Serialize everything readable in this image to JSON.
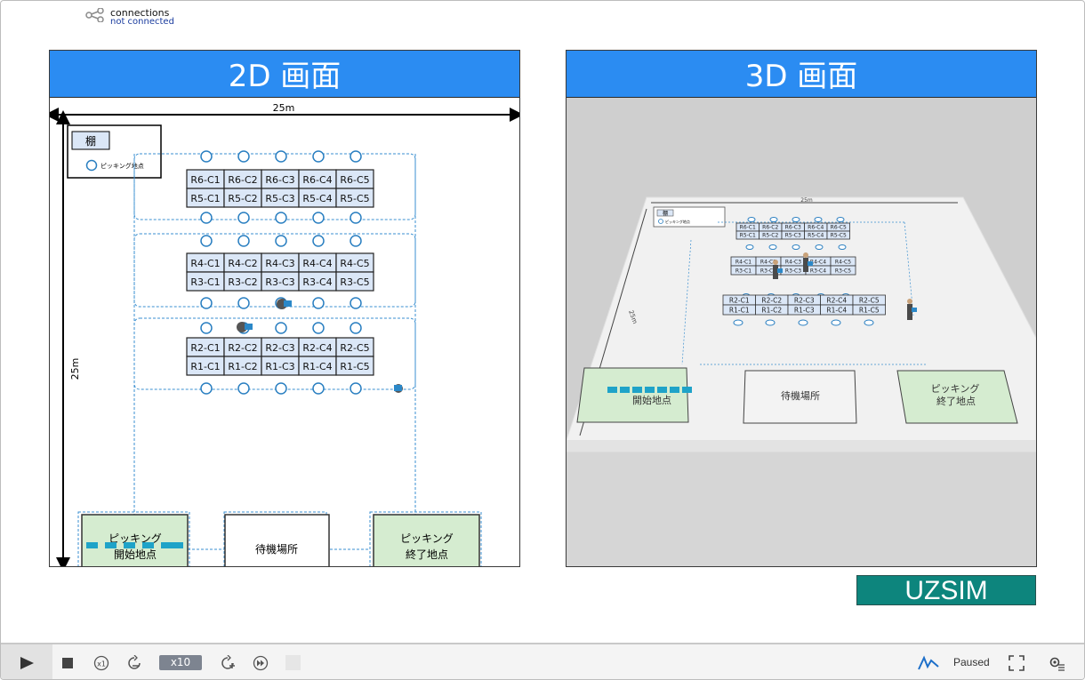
{
  "connection": {
    "label": "connections",
    "status": "not connected"
  },
  "panels": {
    "view2d_title": "2D 画面",
    "view3d_title": "3D 画面"
  },
  "layout2d": {
    "width_label": "25m",
    "height_label": "25m",
    "legend_shelf": "棚",
    "legend_point": "ピッキング地点",
    "shelf_rows": [
      [
        "R6-C1",
        "R6-C2",
        "R6-C3",
        "R6-C4",
        "R6-C5"
      ],
      [
        "R5-C1",
        "R5-C2",
        "R5-C3",
        "R5-C4",
        "R5-C5"
      ],
      [
        "R4-C1",
        "R4-C2",
        "R4-C3",
        "R4-C4",
        "R4-C5"
      ],
      [
        "R3-C1",
        "R3-C2",
        "R3-C3",
        "R3-C4",
        "R3-C5"
      ],
      [
        "R2-C1",
        "R2-C2",
        "R2-C3",
        "R2-C4",
        "R2-C5"
      ],
      [
        "R1-C1",
        "R1-C2",
        "R1-C3",
        "R1-C4",
        "R1-C5"
      ]
    ],
    "zones": {
      "start_line1": "ピッキング",
      "start_line2": "開始地点",
      "wait": "待機場所",
      "end_line1": "ピッキング",
      "end_line2": "終了地点"
    }
  },
  "layout3d": {
    "scale_label": "25m",
    "legend_shelf": "棚",
    "legend_point": "ピッキング地点",
    "zone_start": "開始地点",
    "zone_wait": "待機場所",
    "zone_end_line1": "ピッキング",
    "zone_end_line2": "終了地点"
  },
  "brand": "UZSIM",
  "toolbar": {
    "speed_label": "x10",
    "status": "Paused"
  },
  "colors": {
    "header_blue": "#2b8cf2",
    "shelf_fill": "#dbe7f7",
    "zone_green": "#d5ecd0",
    "route_blue": "#3a8fd0",
    "logo_teal": "#0d857d"
  }
}
